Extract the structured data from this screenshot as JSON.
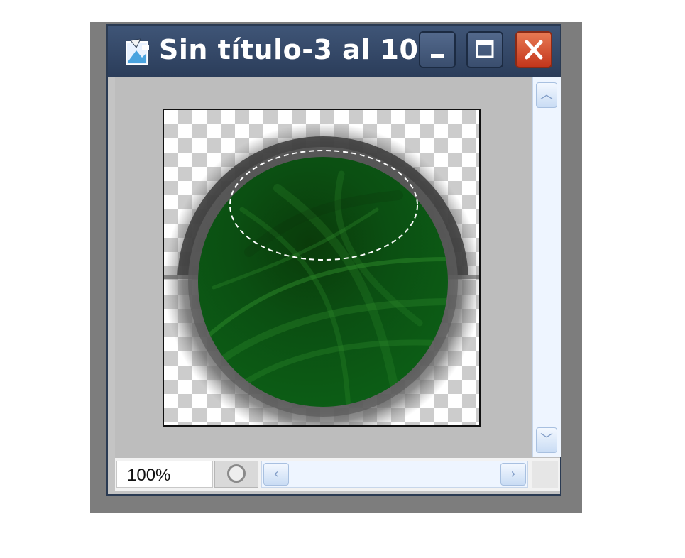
{
  "window": {
    "title": "Sin título-3 al 10...",
    "icon": "document-image-icon"
  },
  "titlebar_buttons": [
    "minimize",
    "maximize",
    "close"
  ],
  "colors": {
    "titlebar": "#33476a",
    "close_button": "#d9512e",
    "canvas_checker": "#cccccc",
    "green_fill": "#0b4f12"
  },
  "status": {
    "zoom": "100%"
  }
}
